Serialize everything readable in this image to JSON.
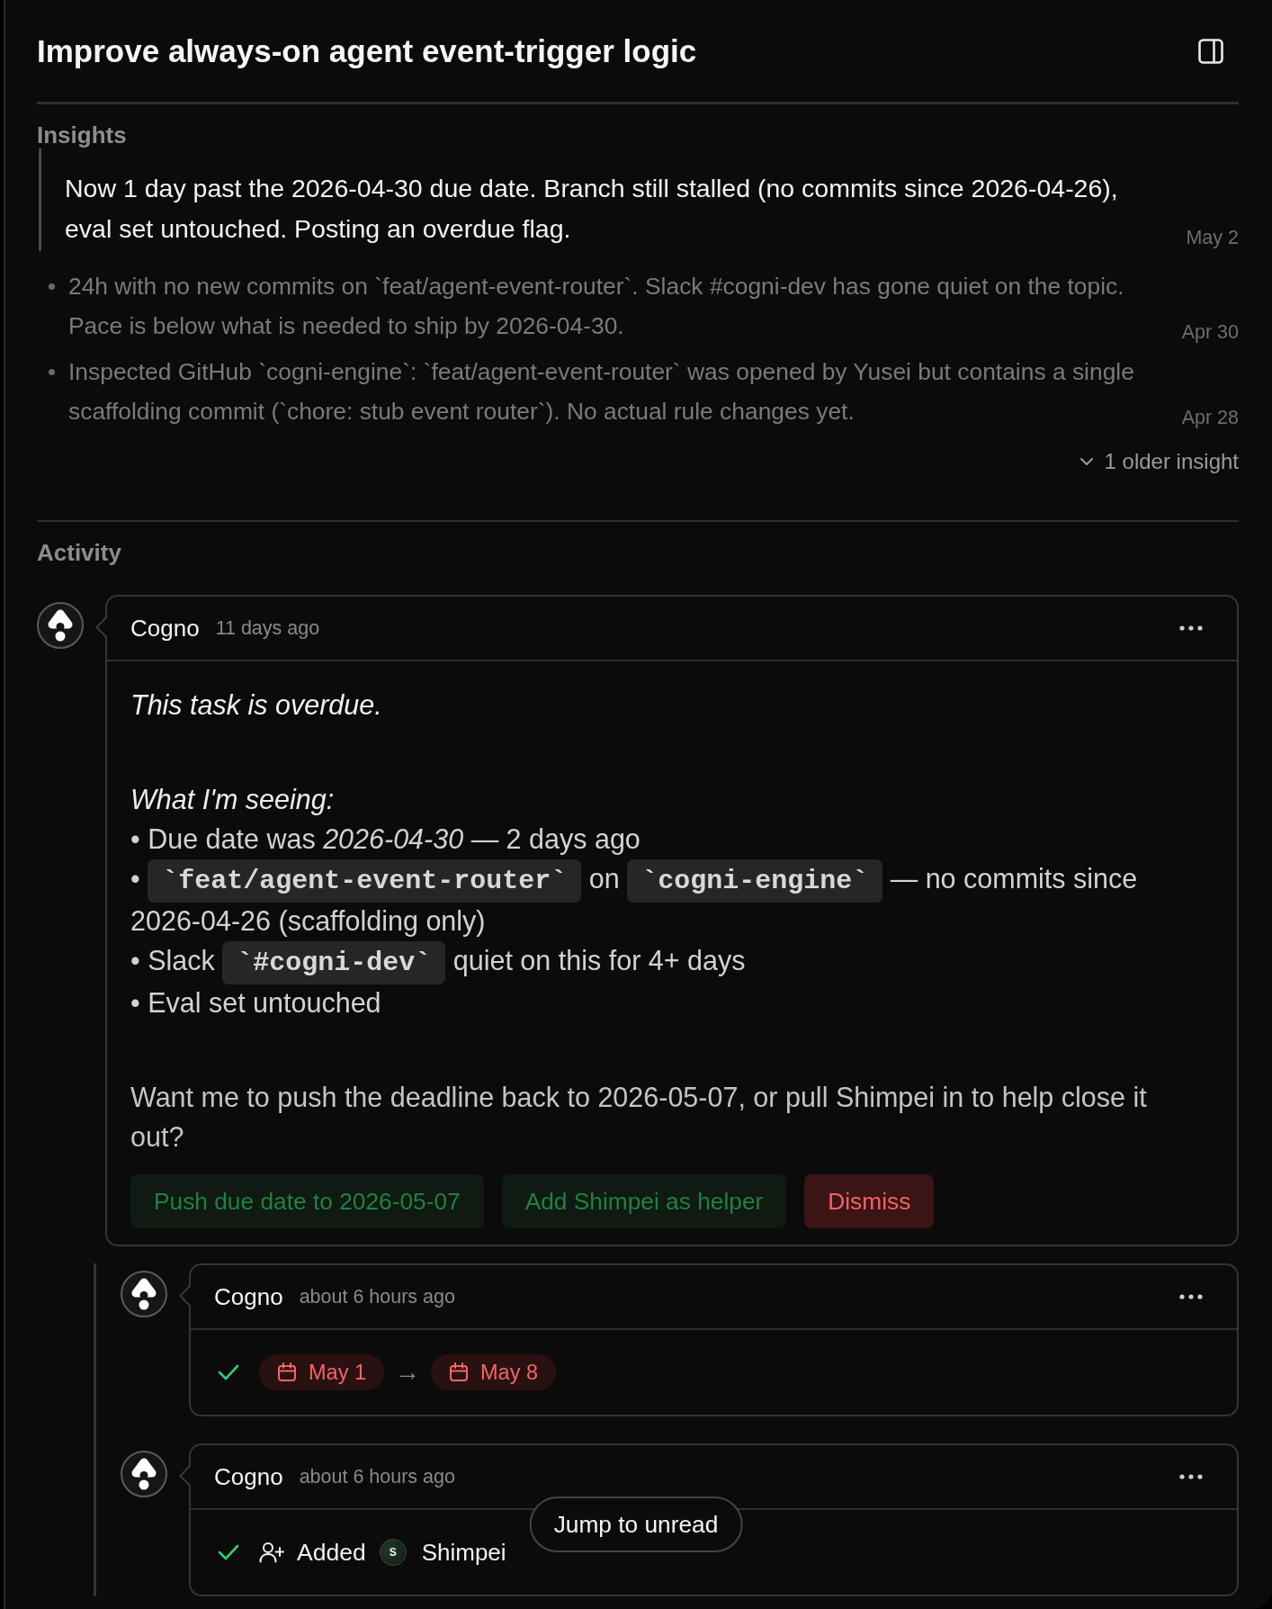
{
  "header": {
    "title": "Improve always-on agent event-trigger logic"
  },
  "insights": {
    "heading": "Insights",
    "items": [
      {
        "kind": "latest",
        "text": "Now 1 day past the 2026-04-30 due date. Branch still stalled (no commits since 2026-04-26), eval set untouched. Posting an overdue flag.",
        "date": "May 2"
      },
      {
        "kind": "older",
        "text": "24h with no new commits on `feat/agent-event-router`. Slack #cogni-dev has gone quiet on the topic. Pace is below what is needed to ship by 2026-04-30.",
        "date": "Apr 30"
      },
      {
        "kind": "older",
        "text": "Inspected GitHub `cogni-engine`: `feat/agent-event-router` was opened by Yusei but contains a single scaffolding commit (`chore: stub event router`). No actual rule changes yet.",
        "date": "Apr 28"
      }
    ],
    "more": {
      "label": "1 older insight",
      "expanded": false
    }
  },
  "activity": {
    "heading": "Activity",
    "comments": [
      {
        "author": "Cogno",
        "time": "11 days ago",
        "blocks": [
          {
            "kind": "lead",
            "text": "This task is overdue."
          },
          {
            "kind": "heading",
            "text": "What I'm seeing:"
          },
          {
            "kind": "bullet",
            "text": "• Due date was *2026-04-30* — 2 days ago"
          },
          {
            "kind": "bullet",
            "segments": [
              {
                "kind": "text",
                "text": "•"
              },
              {
                "kind": "code",
                "text": "`feat/agent-event-router`"
              },
              {
                "kind": "text",
                "text": "on"
              },
              {
                "kind": "code",
                "text": "`cogni-engine`"
              },
              {
                "kind": "text",
                "text": "— no commits since 2026-04-26 (scaffolding only)"
              }
            ]
          },
          {
            "kind": "bullet",
            "segments": [
              {
                "kind": "text",
                "text": "• Slack"
              },
              {
                "kind": "code",
                "text": "`#cogni-dev`"
              },
              {
                "kind": "text",
                "text": "quiet on this for 4+ days"
              }
            ]
          },
          {
            "kind": "bullet",
            "text": "• Eval set untouched"
          },
          {
            "kind": "question",
            "text": "Want me to push the deadline back to 2026-05-07, or pull Shimpei in to help close it out?"
          }
        ],
        "actions": [
          {
            "label": "Push due date to 2026-05-07",
            "kind": "accept"
          },
          {
            "label": "Add Shimpei as helper",
            "kind": "accept"
          },
          {
            "label": "Dismiss",
            "kind": "dismiss"
          }
        ],
        "replies": [
          {
            "author": "Cogno",
            "time": "about 6 hours ago",
            "event": {
              "kind": "date_change",
              "from": "May 1",
              "arrow": "→",
              "to": "May 8"
            }
          },
          {
            "author": "Cogno",
            "time": "about 6 hours ago",
            "event": {
              "kind": "member_added",
              "verb": "Added",
              "initial": "S",
              "name": "Shimpei"
            }
          }
        ]
      }
    ],
    "jump": {
      "label": "Jump to unread"
    }
  }
}
